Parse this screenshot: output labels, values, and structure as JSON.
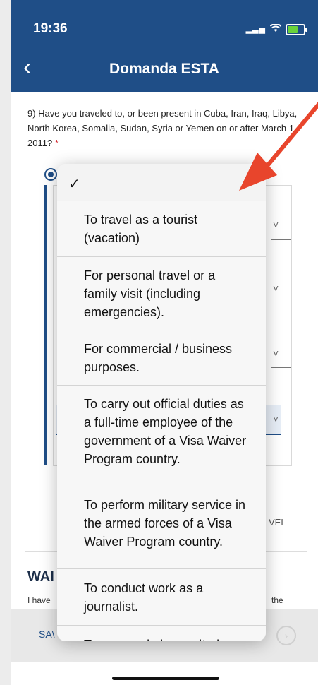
{
  "status": {
    "time": "19:36"
  },
  "header": {
    "title": "Domanda ESTA"
  },
  "question": {
    "text": "9) Have you traveled to, or been present in Cuba, Iran, Iraq, Libya, North Korea, Somalia, Sudan, Syria or Yemen on or after March 1, 2011?",
    "required_mark": "*"
  },
  "background_fields": {
    "partial_label": "VEL"
  },
  "waiver": {
    "title_partial": "WAI",
    "text_left": "I have",
    "text_right": "the"
  },
  "bottom": {
    "save_partial": "SA\\"
  },
  "menu": {
    "selected_mark": "✓",
    "items": [
      {
        "label": "To travel as a tourist (vacation)"
      },
      {
        "label": "For personal travel or a family visit (including emergencies)."
      },
      {
        "label": "For commercial / business purposes."
      },
      {
        "label": "To carry out official duties as a full-time employee of the government of a Visa Waiver Program country."
      },
      {
        "label": "To perform military service in the armed forces of a Visa Waiver Program country."
      },
      {
        "label": "To conduct work as a journalist."
      },
      {
        "label": "To engage in humanitarian"
      }
    ]
  },
  "colors": {
    "header": "#1f4e87",
    "annotation_arrow": "#e8452c"
  }
}
